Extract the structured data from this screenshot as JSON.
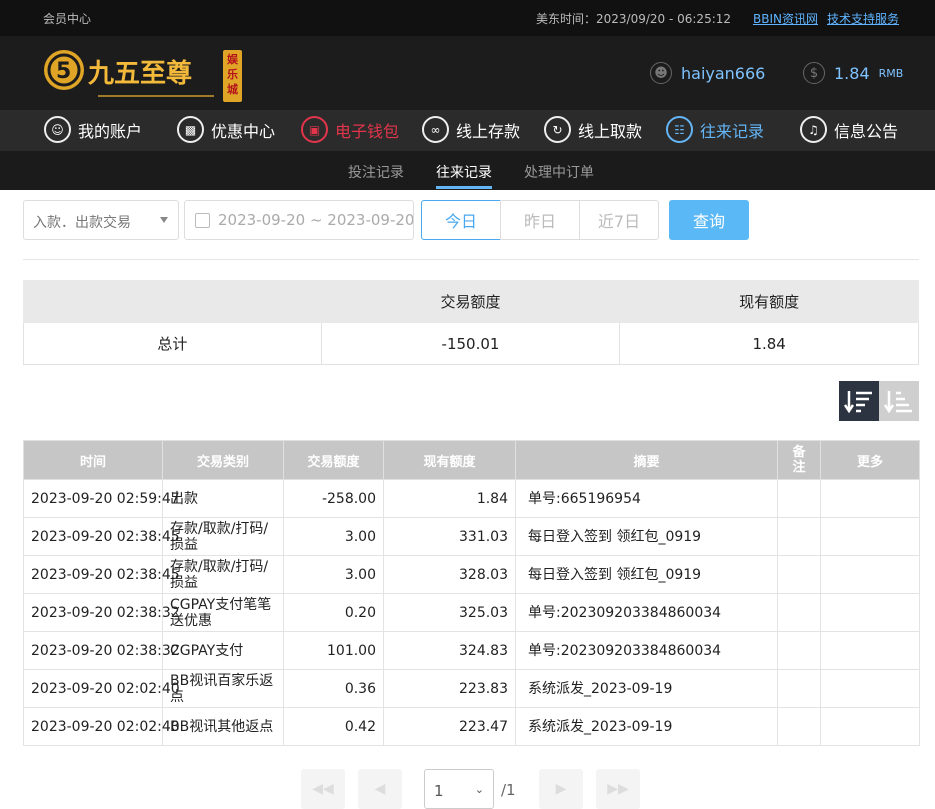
{
  "topbar": {
    "member_center": "会员中心",
    "time_label": "美东时间：2023/09/20 - 06:25:12",
    "link_bbin": "BBIN资讯网",
    "link_support": "技术支持服务"
  },
  "header": {
    "logo_text": "九五至尊",
    "logo_badge": "娱乐城",
    "username": "haiyan666",
    "balance": "1.84",
    "currency": "RMB"
  },
  "nav": {
    "items": [
      {
        "label": "我的账户",
        "icon": "user-icon"
      },
      {
        "label": "优惠中心",
        "icon": "gift-icon"
      },
      {
        "label": "电子钱包",
        "icon": "wallet-icon"
      },
      {
        "label": "线上存款",
        "icon": "deposit-icon"
      },
      {
        "label": "线上取款",
        "icon": "withdraw-icon"
      },
      {
        "label": "往来记录",
        "icon": "record-icon"
      },
      {
        "label": "信息公告",
        "icon": "bell-icon"
      }
    ]
  },
  "subnav": {
    "items": [
      "投注记录",
      "往来记录",
      "处理中订单"
    ],
    "active": "往来记录"
  },
  "filter": {
    "type_select": "入款．出款交易",
    "date_range": "2023-09-20 ~ 2023-09-20",
    "today": "今日",
    "yesterday": "昨日",
    "last7": "近7日",
    "query": "查询"
  },
  "summary": {
    "headers": [
      "",
      "交易额度",
      "现有额度"
    ],
    "row": [
      "总计",
      "-150.01",
      "1.84"
    ]
  },
  "records": {
    "headers": [
      "时间",
      "交易类别",
      "交易额度",
      "现有额度",
      "摘要",
      "备注",
      "更多"
    ],
    "rows": [
      [
        "2023-09-20 02:59:47",
        "出款",
        "-258.00",
        "1.84",
        "单号:665196954",
        "",
        ""
      ],
      [
        "2023-09-20 02:38:45",
        "存款/取款/打码/损益",
        "3.00",
        "331.03",
        "每日登入签到 领红包_0919",
        "",
        ""
      ],
      [
        "2023-09-20 02:38:45",
        "存款/取款/打码/损益",
        "3.00",
        "328.03",
        "每日登入签到 领红包_0919",
        "",
        ""
      ],
      [
        "2023-09-20 02:38:32",
        "CGPAY支付笔笔送优惠",
        "0.20",
        "325.03",
        "单号:202309203384860034",
        "",
        ""
      ],
      [
        "2023-09-20 02:38:32",
        "CGPAY支付",
        "101.00",
        "324.83",
        "单号:202309203384860034",
        "",
        ""
      ],
      [
        "2023-09-20 02:02:40",
        "BB视讯百家乐返点",
        "0.36",
        "223.83",
        "系统派发_2023-09-19",
        "",
        ""
      ],
      [
        "2023-09-20 02:02:40",
        "BB视讯其他返点",
        "0.42",
        "223.47",
        "系统派发_2023-09-19",
        "",
        ""
      ]
    ]
  },
  "pager": {
    "current": "1",
    "total": "/1"
  }
}
